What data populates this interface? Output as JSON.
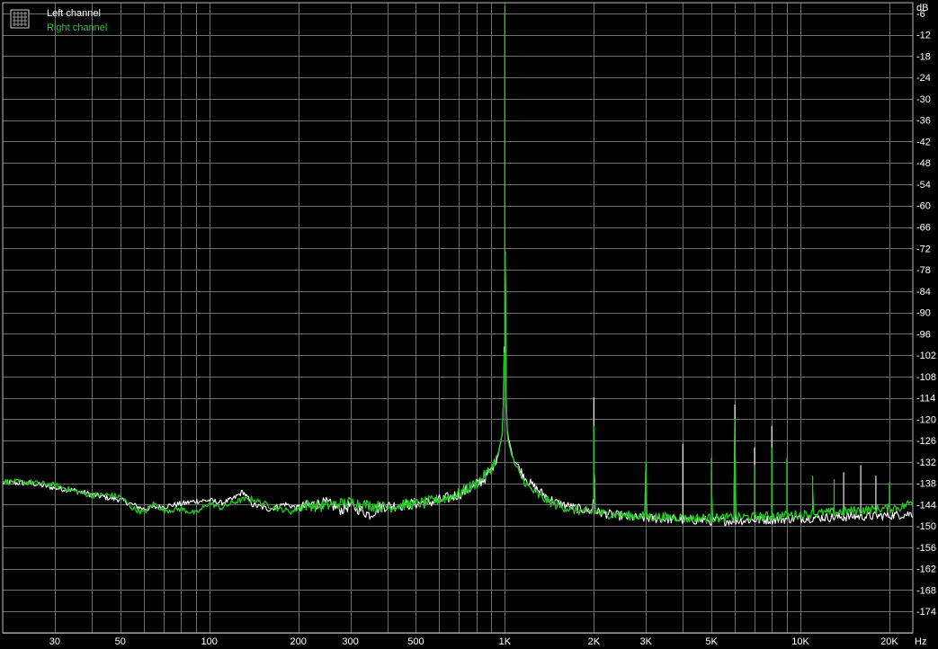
{
  "colors": {
    "background": "#000000",
    "grid": "#6f6f6f",
    "frame": "#bdbdbd",
    "left_channel": "#ffffff",
    "right_channel": "#22cc22",
    "tick_text": "#ffffff"
  },
  "legend": {
    "icon": "grid-icon",
    "placement": "top-left"
  },
  "chart_data": {
    "type": "line",
    "title": "",
    "xlabel": "",
    "ylabel": "",
    "x_unit": "Hz",
    "y_unit": "dB",
    "x_scale": "log",
    "xlim": [
      20,
      24000
    ],
    "ylim": [
      -180,
      -3
    ],
    "grid": true,
    "legend_placement": "top-left",
    "x_ticks": [
      {
        "value": 30,
        "label": "30"
      },
      {
        "value": 50,
        "label": "50"
      },
      {
        "value": 100,
        "label": "100"
      },
      {
        "value": 200,
        "label": "200"
      },
      {
        "value": 300,
        "label": "300"
      },
      {
        "value": 500,
        "label": "500"
      },
      {
        "value": 1000,
        "label": "1K"
      },
      {
        "value": 2000,
        "label": "2K"
      },
      {
        "value": 3000,
        "label": "3K"
      },
      {
        "value": 5000,
        "label": "5K"
      },
      {
        "value": 10000,
        "label": "10K"
      },
      {
        "value": 20000,
        "label": "20K"
      }
    ],
    "y_ticks": [
      {
        "value": -6,
        "label": "-6"
      },
      {
        "value": -12,
        "label": "-12"
      },
      {
        "value": -18,
        "label": "-18"
      },
      {
        "value": -24,
        "label": "-24"
      },
      {
        "value": -30,
        "label": "-30"
      },
      {
        "value": -36,
        "label": "-36"
      },
      {
        "value": -42,
        "label": "-42"
      },
      {
        "value": -48,
        "label": "-48"
      },
      {
        "value": -54,
        "label": "-54"
      },
      {
        "value": -60,
        "label": "-60"
      },
      {
        "value": -66,
        "label": "-66"
      },
      {
        "value": -72,
        "label": "-72"
      },
      {
        "value": -78,
        "label": "-78"
      },
      {
        "value": -84,
        "label": "-84"
      },
      {
        "value": -90,
        "label": "-90"
      },
      {
        "value": -96,
        "label": "-96"
      },
      {
        "value": -102,
        "label": "-102"
      },
      {
        "value": -108,
        "label": "-108"
      },
      {
        "value": -114,
        "label": "-114"
      },
      {
        "value": -120,
        "label": "-120"
      },
      {
        "value": -126,
        "label": "-126"
      },
      {
        "value": -132,
        "label": "-132"
      },
      {
        "value": -138,
        "label": "-138"
      },
      {
        "value": -144,
        "label": "-144"
      },
      {
        "value": -150,
        "label": "-150"
      },
      {
        "value": -156,
        "label": "-156"
      },
      {
        "value": -162,
        "label": "-162"
      },
      {
        "value": -168,
        "label": "-168"
      },
      {
        "value": -174,
        "label": "-174"
      }
    ],
    "series": [
      {
        "name": "Left channel",
        "color": "#ffffff",
        "points": [
          [
            20,
            -137.8
          ],
          [
            25,
            -138.0
          ],
          [
            30,
            -139.3
          ],
          [
            35,
            -140.0
          ],
          [
            40,
            -141.2
          ],
          [
            45,
            -142.0
          ],
          [
            50,
            -142.6
          ],
          [
            55,
            -144.0
          ],
          [
            60,
            -145.2
          ],
          [
            70,
            -144.5
          ],
          [
            80,
            -143.8
          ],
          [
            90,
            -143.0
          ],
          [
            100,
            -142.8
          ],
          [
            110,
            -143.5
          ],
          [
            120,
            -142.5
          ],
          [
            130,
            -140.3
          ],
          [
            140,
            -144.0
          ],
          [
            160,
            -145.3
          ],
          [
            180,
            -143.8
          ],
          [
            200,
            -145.0
          ],
          [
            220,
            -144.0
          ],
          [
            250,
            -143.5
          ],
          [
            280,
            -145.5
          ],
          [
            300,
            -144.2
          ],
          [
            350,
            -146.8
          ],
          [
            380,
            -144.5
          ],
          [
            420,
            -144.3
          ],
          [
            460,
            -144.0
          ],
          [
            500,
            -143.6
          ],
          [
            550,
            -143.4
          ],
          [
            600,
            -142.8
          ],
          [
            650,
            -142.0
          ],
          [
            700,
            -141.0
          ],
          [
            750,
            -139.8
          ],
          [
            800,
            -138.5
          ],
          [
            850,
            -136.8
          ],
          [
            900,
            -134.3
          ],
          [
            950,
            -130.0
          ],
          [
            980,
            -124.0
          ],
          [
            995,
            -108.0
          ],
          [
            1000,
            -6.0
          ],
          [
            1005,
            -108.0
          ],
          [
            1020,
            -124.0
          ],
          [
            1060,
            -130.0
          ],
          [
            1120,
            -134.0
          ],
          [
            1200,
            -137.5
          ],
          [
            1300,
            -140.0
          ],
          [
            1400,
            -142.0
          ],
          [
            1500,
            -143.5
          ],
          [
            1700,
            -144.8
          ],
          [
            1950,
            -145.8
          ],
          [
            1990,
            -145.5
          ],
          [
            2000,
            -114.0
          ],
          [
            2010,
            -145.5
          ],
          [
            2100,
            -146.3
          ],
          [
            2400,
            -147.0
          ],
          [
            2600,
            -147.5
          ],
          [
            2990,
            -147.8
          ],
          [
            3000,
            -133.0
          ],
          [
            3010,
            -147.8
          ],
          [
            3500,
            -148.0
          ],
          [
            3990,
            -148.2
          ],
          [
            4000,
            -127.0
          ],
          [
            4010,
            -148.2
          ],
          [
            4500,
            -148.4
          ],
          [
            4990,
            -148.5
          ],
          [
            5000,
            -135.0
          ],
          [
            5010,
            -148.5
          ],
          [
            5500,
            -148.5
          ],
          [
            5990,
            -148.5
          ],
          [
            6000,
            -116.0
          ],
          [
            6010,
            -148.5
          ],
          [
            6500,
            -148.4
          ],
          [
            6990,
            -148.3
          ],
          [
            7000,
            -128.0
          ],
          [
            7010,
            -148.3
          ],
          [
            7500,
            -148.3
          ],
          [
            7990,
            -148.2
          ],
          [
            8000,
            -122.0
          ],
          [
            8010,
            -148.2
          ],
          [
            8500,
            -148.1
          ],
          [
            9000,
            -148.0
          ],
          [
            10000,
            -147.8
          ],
          [
            12000,
            -147.6
          ],
          [
            13990,
            -147.5
          ],
          [
            14000,
            -135.0
          ],
          [
            14010,
            -147.5
          ],
          [
            15000,
            -147.3
          ],
          [
            15990,
            -147.3
          ],
          [
            16000,
            -133.0
          ],
          [
            16010,
            -147.3
          ],
          [
            17000,
            -147.3
          ],
          [
            17990,
            -147.2
          ],
          [
            18000,
            -136.0
          ],
          [
            18010,
            -147.2
          ],
          [
            20000,
            -147.0
          ],
          [
            22000,
            -146.8
          ],
          [
            24000,
            -146.5
          ]
        ]
      },
      {
        "name": "Right channel",
        "color": "#22cc22",
        "points": [
          [
            20,
            -137.5
          ],
          [
            25,
            -137.8
          ],
          [
            30,
            -138.5
          ],
          [
            35,
            -140.2
          ],
          [
            40,
            -141.4
          ],
          [
            45,
            -141.2
          ],
          [
            50,
            -141.8
          ],
          [
            55,
            -145.0
          ],
          [
            60,
            -146.3
          ],
          [
            65,
            -143.6
          ],
          [
            70,
            -145.7
          ],
          [
            80,
            -145.2
          ],
          [
            90,
            -146.5
          ],
          [
            100,
            -143.5
          ],
          [
            110,
            -145.0
          ],
          [
            120,
            -143.4
          ],
          [
            130,
            -142.6
          ],
          [
            140,
            -142.4
          ],
          [
            150,
            -143.5
          ],
          [
            170,
            -145.0
          ],
          [
            190,
            -146.0
          ],
          [
            210,
            -144.0
          ],
          [
            240,
            -144.5
          ],
          [
            270,
            -143.8
          ],
          [
            300,
            -143.2
          ],
          [
            340,
            -144.0
          ],
          [
            400,
            -144.8
          ],
          [
            450,
            -144.0
          ],
          [
            500,
            -143.8
          ],
          [
            550,
            -143.2
          ],
          [
            600,
            -142.6
          ],
          [
            650,
            -141.8
          ],
          [
            700,
            -140.8
          ],
          [
            750,
            -139.4
          ],
          [
            800,
            -138.0
          ],
          [
            850,
            -136.0
          ],
          [
            900,
            -133.8
          ],
          [
            950,
            -129.5
          ],
          [
            980,
            -124.0
          ],
          [
            995,
            -110.0
          ],
          [
            1000,
            -4.0
          ],
          [
            1005,
            -110.0
          ],
          [
            1020,
            -125.0
          ],
          [
            1060,
            -131.0
          ],
          [
            1120,
            -135.5
          ],
          [
            1200,
            -139.0
          ],
          [
            1300,
            -141.5
          ],
          [
            1400,
            -143.0
          ],
          [
            1500,
            -144.2
          ],
          [
            1700,
            -145.5
          ],
          [
            1950,
            -146.2
          ],
          [
            1990,
            -146.0
          ],
          [
            2000,
            -122.0
          ],
          [
            2010,
            -146.0
          ],
          [
            2200,
            -146.6
          ],
          [
            2400,
            -146.8
          ],
          [
            2600,
            -147.0
          ],
          [
            2800,
            -147.2
          ],
          [
            2990,
            -147.3
          ],
          [
            3000,
            -132.0
          ],
          [
            3010,
            -147.3
          ],
          [
            3500,
            -147.5
          ],
          [
            3990,
            -147.5
          ],
          [
            4000,
            -148.0
          ],
          [
            4500,
            -147.7
          ],
          [
            4990,
            -147.8
          ],
          [
            5000,
            -131.0
          ],
          [
            5010,
            -147.8
          ],
          [
            5500,
            -147.7
          ],
          [
            5990,
            -147.6
          ],
          [
            6000,
            -120.0
          ],
          [
            6010,
            -147.6
          ],
          [
            6500,
            -147.5
          ],
          [
            6990,
            -147.4
          ],
          [
            7000,
            -133.0
          ],
          [
            7010,
            -147.4
          ],
          [
            7500,
            -147.3
          ],
          [
            7990,
            -147.2
          ],
          [
            8000,
            -128.0
          ],
          [
            8010,
            -147.2
          ],
          [
            8500,
            -147.1
          ],
          [
            8990,
            -147.0
          ],
          [
            9000,
            -131.0
          ],
          [
            9010,
            -147.0
          ],
          [
            10000,
            -146.8
          ],
          [
            10990,
            -146.6
          ],
          [
            11000,
            -136.0
          ],
          [
            11010,
            -146.6
          ],
          [
            12000,
            -146.3
          ],
          [
            12990,
            -146.1
          ],
          [
            13000,
            -137.0
          ],
          [
            13010,
            -146.1
          ],
          [
            14000,
            -145.9
          ],
          [
            15000,
            -145.7
          ],
          [
            16000,
            -145.5
          ],
          [
            17000,
            -145.4
          ],
          [
            18000,
            -145.3
          ],
          [
            19990,
            -145.0
          ],
          [
            20000,
            -138.0
          ],
          [
            20010,
            -145.0
          ],
          [
            22000,
            -144.7
          ],
          [
            24000,
            -143.0
          ]
        ]
      }
    ]
  }
}
